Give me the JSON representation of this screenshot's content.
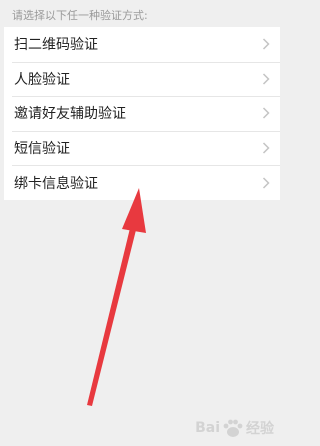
{
  "prompt_text": "请选择以下任一种验证方式:",
  "methods": [
    {
      "label": "扫二维码验证"
    },
    {
      "label": "人脸验证"
    },
    {
      "label": "邀请好友辅助验证"
    },
    {
      "label": "短信验证"
    },
    {
      "label": "绑卡信息验证"
    }
  ],
  "watermark": {
    "brand_prefix": "Bai",
    "brand_suffix": "经验"
  },
  "colors": {
    "annotation_arrow": "#e8393f"
  },
  "icons": {
    "row_chevron": "chevron-right-icon",
    "watermark_logo": "paw-icon"
  }
}
